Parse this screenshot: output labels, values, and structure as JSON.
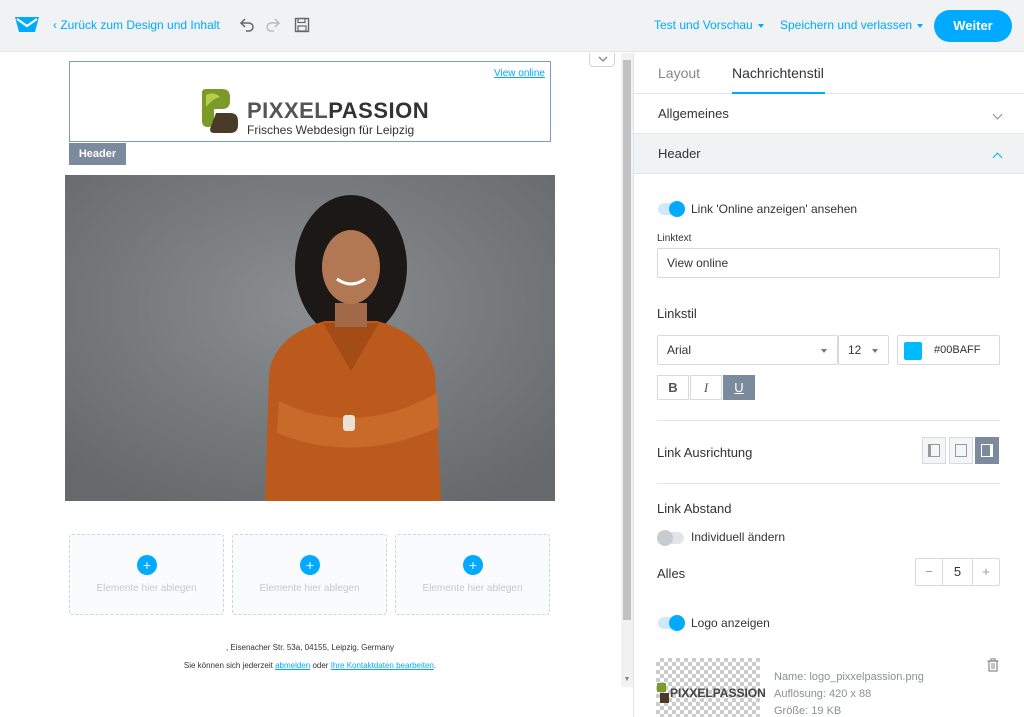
{
  "app": {
    "back_label": "Zurück zum Design und Inhalt",
    "menu_test": "Test und Vorschau",
    "menu_save": "Speichern und verlassen",
    "continue_label": "Weiter"
  },
  "email": {
    "view_online": "View online",
    "brand_part1": "PIXXEL",
    "brand_part2": "PASSION",
    "brand_tagline": "Frisches Webdesign für Leipzig",
    "header_tag": "Header",
    "drop_label": "Elemente hier ablegen",
    "footer_address": ", Eisenacher Str. 53a, 04155, Leipzig, Germany",
    "footer_prefix": "Sie können sich jederzeit",
    "footer_unsubscribe": "abmelden",
    "footer_middle": "oder",
    "footer_edit": "Ihre Kontaktdaten bearbeiten",
    "footer_suffix": "."
  },
  "panel": {
    "tabs": [
      "Layout",
      "Nachrichtenstil"
    ],
    "section_general": "Allgemeines",
    "section_header": "Header",
    "toggle_link_label": "Link 'Online anzeigen' ansehen",
    "linktext_label": "Linktext",
    "linktext_value": "View online",
    "linkstil_label": "Linkstil",
    "font_value": "Arial",
    "size_value": "12",
    "color_value": "#00BAFF",
    "bold": "B",
    "italic": "I",
    "underline": "U",
    "align_label": "Link Ausrichtung",
    "spacing_label": "Link Abstand",
    "individual_label": "Individuell ändern",
    "all_label": "Alles",
    "stepper_minus": "−",
    "stepper_value": "5",
    "stepper_plus": "+",
    "logo_toggle_label": "Logo anzeigen",
    "logo_name": "Name: logo_pixxelpassion.png",
    "logo_resolution": "Auflösung: 420 x 88",
    "logo_size": "Größe: 19 KB"
  },
  "colors": {
    "accent": "#00AAFF",
    "swatch": "#00BAFF",
    "tag_bg": "#7B8A9C"
  }
}
